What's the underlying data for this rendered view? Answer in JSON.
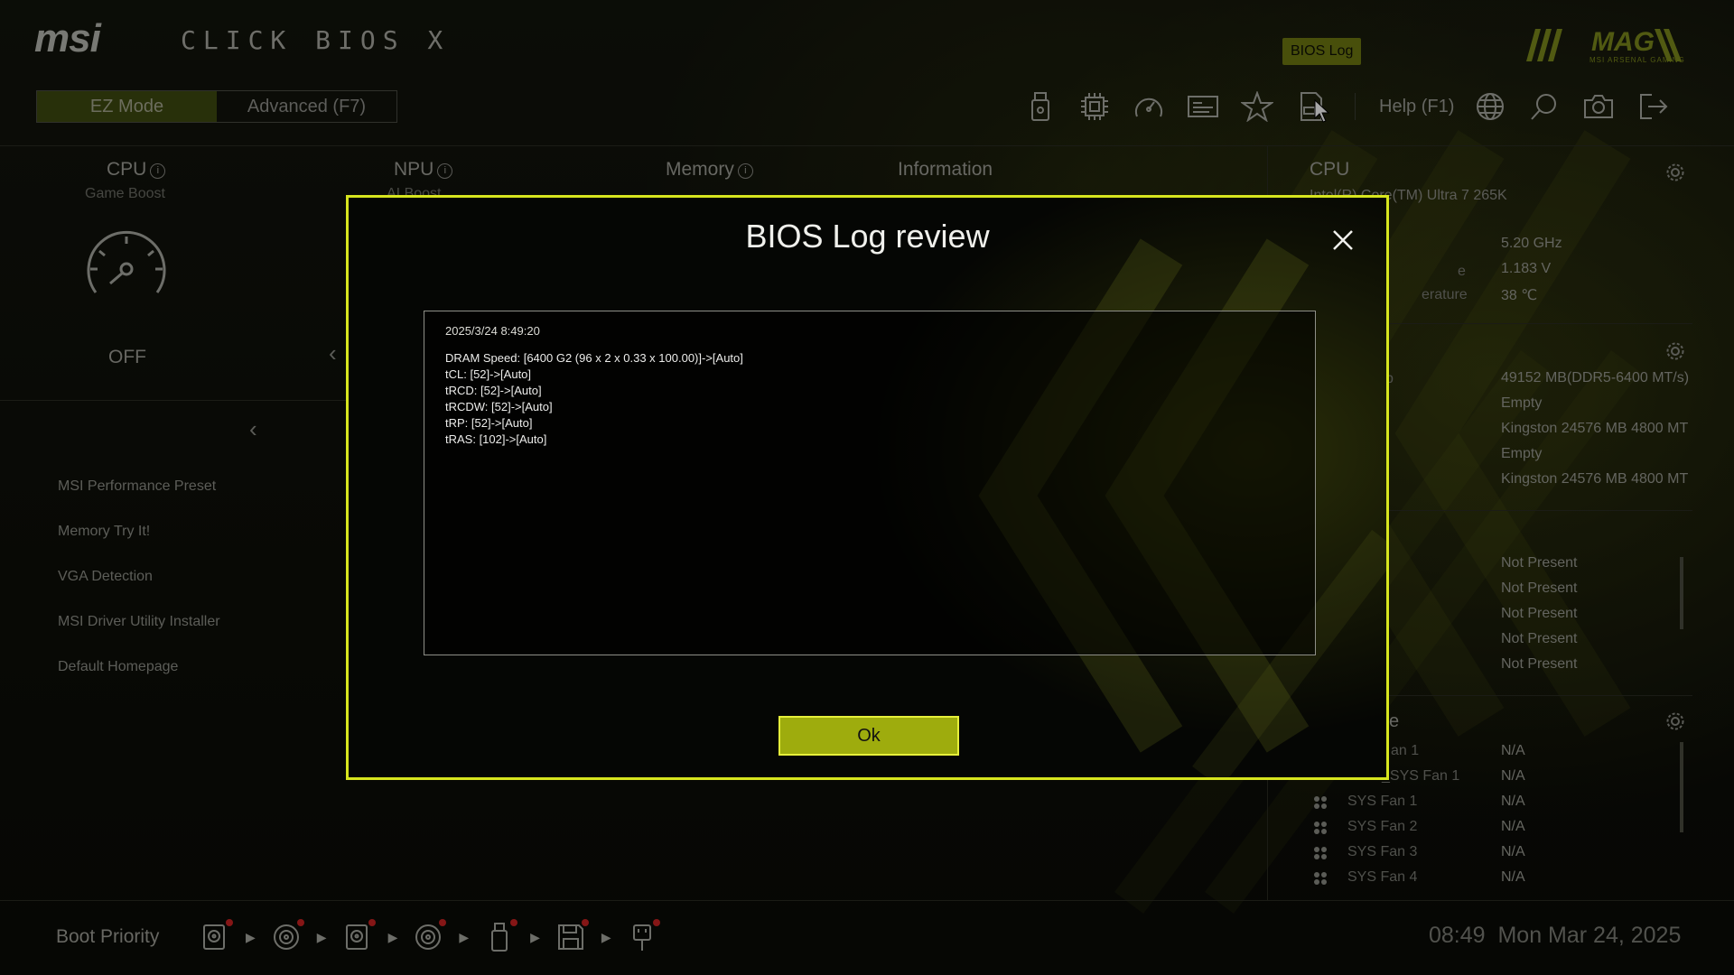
{
  "app": {
    "brand": "msi",
    "title": "CLICK BIOS X",
    "series_logo": "MAG",
    "series_sub": "MSI ARSENAL GAMING"
  },
  "mode": {
    "ez_label": "EZ Mode",
    "advanced_label": "Advanced (F7)",
    "active": "ez"
  },
  "toolbar": {
    "icons": [
      "usb-icon",
      "cpu-chip-icon",
      "gauge-icon",
      "id-card-icon",
      "star-icon",
      "bios-log-icon"
    ],
    "tooltip": "BIOS Log",
    "help_label": "Help (F1)",
    "right_icons": [
      "globe-icon",
      "search-icon",
      "camera-icon",
      "exit-icon"
    ]
  },
  "tabs": {
    "cpu": {
      "label": "CPU",
      "sub": "Game Boost"
    },
    "npu": {
      "label": "NPU",
      "sub": "AI Boost"
    },
    "memory": {
      "label": "Memory"
    },
    "information": {
      "label": "Information"
    }
  },
  "left_panel": {
    "game_boost_state": "OFF",
    "menu": [
      "MSI Performance Preset",
      "Memory Try It!",
      "VGA Detection",
      "MSI Driver Utility Installer",
      "Default Homepage"
    ]
  },
  "right_panel": {
    "cpu_title": "CPU",
    "cpu_name": "Intel(R) Core(TM) Ultra 7 265K",
    "cpu_values": [
      "5.20 GHz",
      "1.183 V",
      "38 ℃"
    ],
    "cpu_labels": [
      "",
      "e",
      "erature"
    ],
    "memory_label_fragment": "p",
    "memory_values": [
      "49152 MB(DDR5-6400 MT/s)",
      "Empty",
      "Kingston 24576 MB 4800 MT",
      "Empty",
      "Kingston 24576 MB 4800 MT"
    ],
    "storage_values": [
      "Not Present",
      "Not Present",
      "Not Present",
      "Not Present",
      "Not Present"
    ],
    "fan_title_fragment": "e",
    "fans": [
      {
        "name": "an 1",
        "value": "N/A"
      },
      {
        "name": "_SYS Fan 1",
        "value": "N/A"
      },
      {
        "name": "SYS Fan 1",
        "value": "N/A"
      },
      {
        "name": "SYS Fan 2",
        "value": "N/A"
      },
      {
        "name": "SYS Fan 3",
        "value": "N/A"
      },
      {
        "name": "SYS Fan 4",
        "value": "N/A"
      }
    ]
  },
  "bottom": {
    "boot_label": "Boot Priority",
    "boot_devices": [
      "hdd-usb-icon",
      "disc-usb-icon",
      "hdd-usb-icon",
      "disc-usb-icon",
      "usb-key-icon",
      "floppy-usb-icon",
      "usb-plug-icon"
    ],
    "time": "08:49",
    "date": "Mon Mar 24, 2025"
  },
  "modal": {
    "title": "BIOS Log review",
    "log_time": "2025/3/24 8:49:20",
    "log_lines": [
      "DRAM Speed: [6400 G2 (96 x 2 x 0.33 x 100.00)]->[Auto]",
      "tCL: [52]->[Auto]",
      "tRCD: [52]->[Auto]",
      "tRCDW: [52]->[Auto]",
      "tRP: [52]->[Auto]",
      "tRAS: [102]->[Auto]"
    ],
    "ok_label": "Ok"
  },
  "colors": {
    "accent": "#d7e51e",
    "ok_button": "#9eac0d",
    "tooltip_bg": "#6f7a12",
    "mode_active_bg": "#3e4a10",
    "background": "#0b0c08"
  }
}
